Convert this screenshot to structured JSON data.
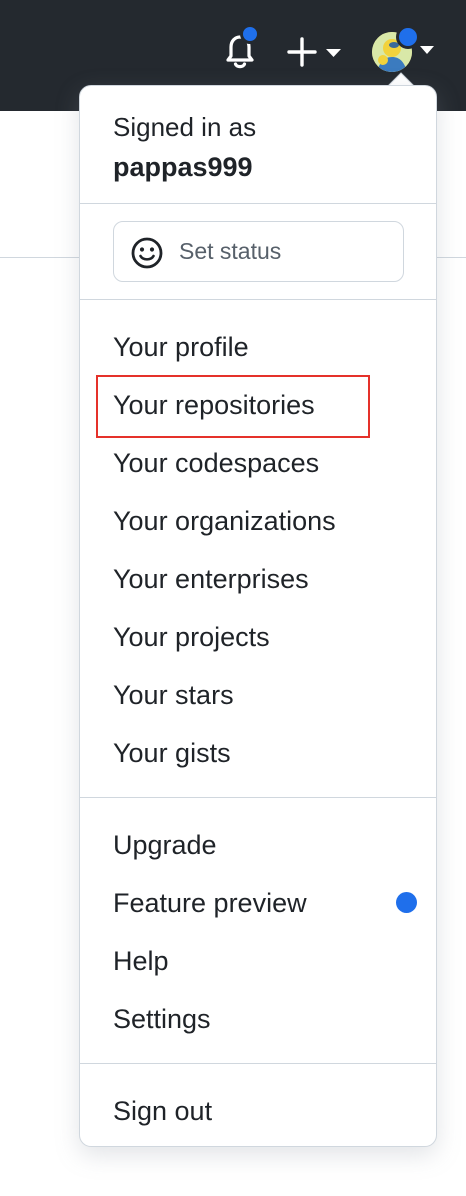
{
  "header": {
    "notifications_icon": "bell-icon",
    "create_icon": "plus-icon",
    "avatar_icon": "avatar-image",
    "unread_color": "#1f6feb"
  },
  "dropdown": {
    "signed_in_label": "Signed in as",
    "username": "pappas999",
    "status_button": {
      "label": "Set status",
      "icon": "smiley-icon"
    },
    "personal_items": [
      {
        "label": "Your profile"
      },
      {
        "label": "Your repositories",
        "highlighted": true
      },
      {
        "label": "Your codespaces"
      },
      {
        "label": "Your organizations"
      },
      {
        "label": "Your enterprises"
      },
      {
        "label": "Your projects"
      },
      {
        "label": "Your stars"
      },
      {
        "label": "Your gists"
      }
    ],
    "account_items": [
      {
        "label": "Upgrade"
      },
      {
        "label": "Feature preview",
        "badge": "blue-dot"
      },
      {
        "label": "Help"
      },
      {
        "label": "Settings"
      }
    ],
    "sign_out_label": "Sign out",
    "highlight_color": "#e5312a"
  }
}
